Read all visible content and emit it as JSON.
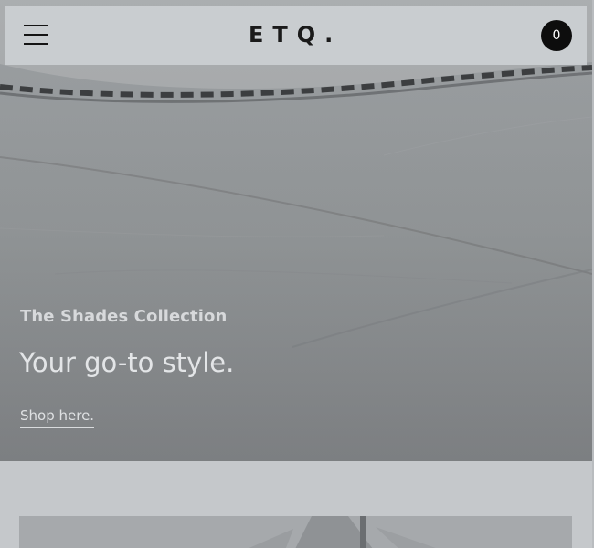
{
  "header": {
    "menu_icon": "hamburger-menu-icon",
    "logo": "ETQ.",
    "cart_count": "0"
  },
  "hero": {
    "subtitle": "The Shades Collection",
    "title": "Your go-to style.",
    "link": "Shop here."
  },
  "colors": {
    "page_background": "#c5c8cb",
    "header_background": "#cccfd2",
    "cart_badge": "#0d0d0d",
    "hero_text": "#e3e5e7"
  }
}
